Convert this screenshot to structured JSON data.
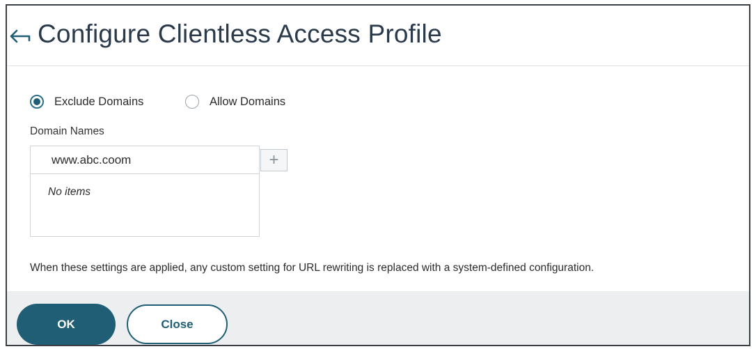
{
  "header": {
    "title": "Configure Clientless Access Profile",
    "back_icon": "back-arrow-icon"
  },
  "domain_mode": {
    "options": [
      {
        "label": "Exclude Domains",
        "checked": true
      },
      {
        "label": "Allow Domains",
        "checked": false
      }
    ]
  },
  "domain_names": {
    "label": "Domain Names",
    "input_value": "www.abc.coom",
    "add_icon": "plus-icon",
    "add_label": "+",
    "empty_text": "No items"
  },
  "note": "When these settings are applied, any custom setting for URL rewriting is replaced with a system-defined configuration.",
  "footer": {
    "ok_label": "OK",
    "close_label": "Close"
  },
  "colors": {
    "accent": "#1f5e75",
    "footer_bg": "#eceef0",
    "title": "#2a3a4a"
  }
}
